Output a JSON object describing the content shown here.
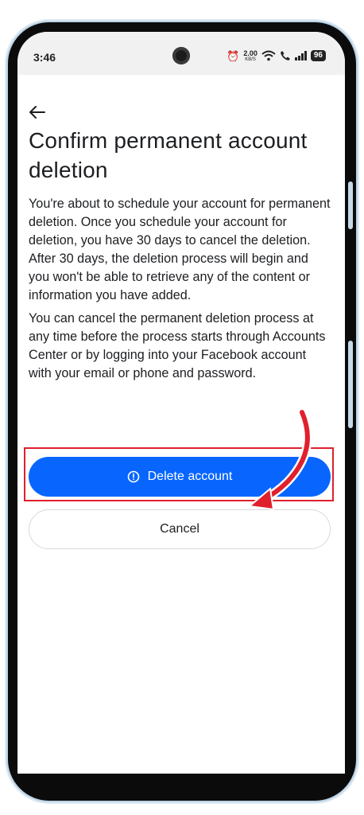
{
  "status_bar": {
    "time": "3:46",
    "net_speed_value": "2.00",
    "net_speed_unit": "KB/S",
    "battery": "96"
  },
  "page": {
    "title": "Confirm permanent account deletion",
    "paragraph_1": "You're about to schedule your account for permanent deletion. Once you schedule your account for deletion, you have 30 days to cancel the deletion. After 30 days, the deletion process will begin and you won't be able to retrieve any of the content or information you have added.",
    "paragraph_2": "You can cancel the permanent deletion process at any time before the process starts through Accounts Center or by logging into your Facebook account with your email or phone and password."
  },
  "buttons": {
    "delete_label": "Delete account",
    "cancel_label": "Cancel"
  },
  "colors": {
    "primary_blue": "#0866ff",
    "highlight_red": "#e0202d"
  },
  "icons": {
    "back": "arrow-left-icon",
    "delete": "alert-circle-icon",
    "annotation": "red-curved-arrow"
  }
}
